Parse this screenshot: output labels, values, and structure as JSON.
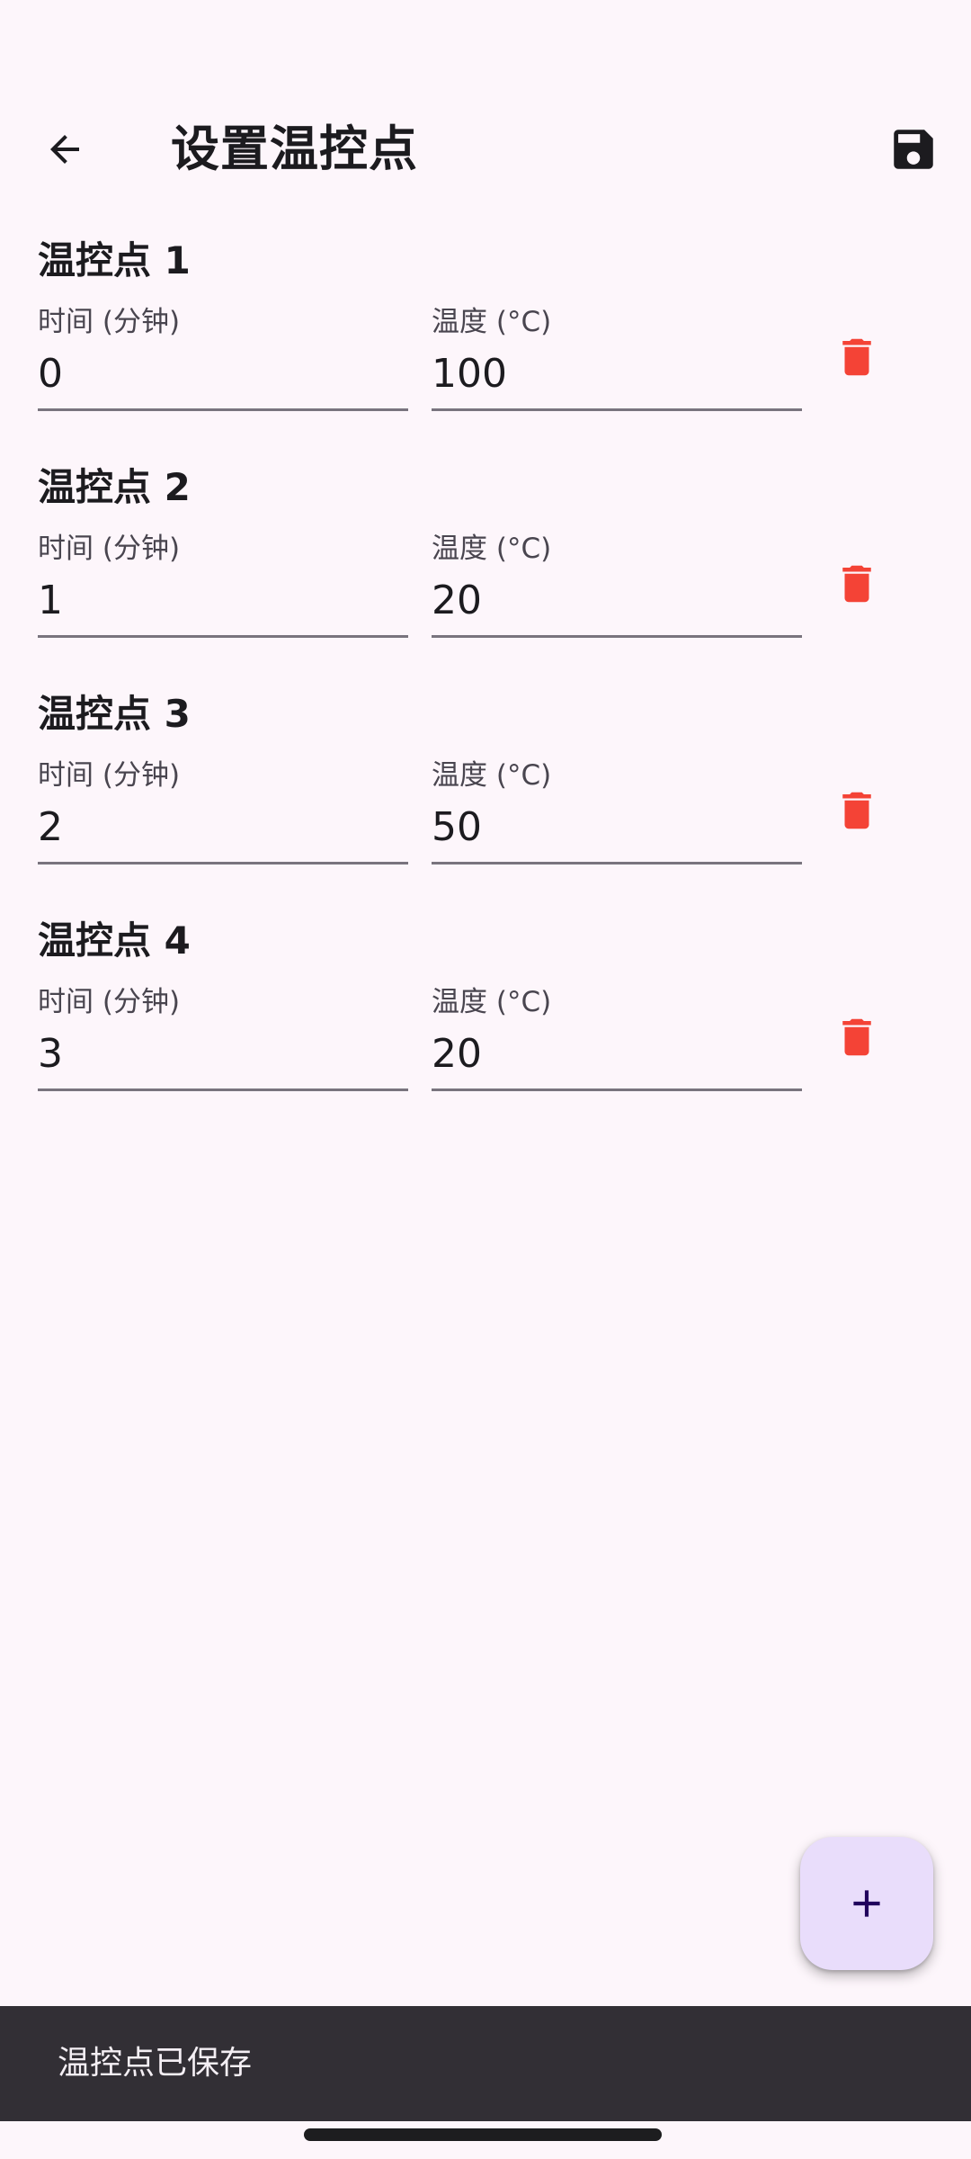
{
  "header": {
    "title": "设置温控点",
    "back_icon": "arrow-left-icon",
    "save_icon": "floppy-disk-icon"
  },
  "points": [
    {
      "title": "温控点 1",
      "time_label": "时间 (分钟)",
      "time_value": "0",
      "temp_label": "温度 (°C)",
      "temp_value": "100"
    },
    {
      "title": "温控点 2",
      "time_label": "时间 (分钟)",
      "time_value": "1",
      "temp_label": "温度 (°C)",
      "temp_value": "20"
    },
    {
      "title": "温控点 3",
      "time_label": "时间 (分钟)",
      "time_value": "2",
      "temp_label": "温度 (°C)",
      "temp_value": "50"
    },
    {
      "title": "温控点 4",
      "time_label": "时间 (分钟)",
      "time_value": "3",
      "temp_label": "温度 (°C)",
      "temp_value": "20"
    }
  ],
  "fab": {
    "icon": "plus-icon"
  },
  "snackbar": {
    "message": "温控点已保存"
  },
  "colors": {
    "background": "#fdf6fb",
    "delete": "#f44336",
    "fab": "#e9ddfb",
    "snackbar": "#322f35"
  }
}
